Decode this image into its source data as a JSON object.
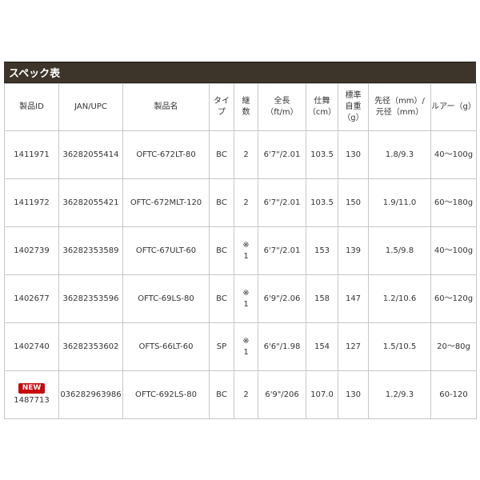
{
  "title": "スペック表",
  "headers": {
    "id": "製品ID",
    "jan": "JAN/UPC",
    "name": "製品名",
    "type_a": "タイ",
    "type_b": "プ",
    "pieces_a": "継",
    "pieces_b": "数",
    "length_a": "全長",
    "length_b": "（ft/m）",
    "close_a": "仕舞",
    "close_b": "（cm）",
    "weight_a": "標準",
    "weight_b": "自重",
    "weight_c": "（g）",
    "dia_a": "先径（mm）/",
    "dia_b": "元径（mm）",
    "lure": "ルアー（g）"
  },
  "new_label": "NEW",
  "rows": [
    {
      "id": "1411971",
      "jan": "36282055414",
      "name": "OFTC-672LT-80",
      "type": "BC",
      "pieces_a": "2",
      "pieces_b": "",
      "length": "6'7\"/2.01",
      "close": "103.5",
      "weight": "130",
      "dia": "1.8/9.3",
      "lure": "40〜100g"
    },
    {
      "id": "1411972",
      "jan": "36282055421",
      "name": "OFTC-672MLT-120",
      "type": "BC",
      "pieces_a": "2",
      "pieces_b": "",
      "length": "6'7\"/2.01",
      "close": "103.5",
      "weight": "150",
      "dia": "1.9/11.0",
      "lure": "60〜180g"
    },
    {
      "id": "1402739",
      "jan": "36282353589",
      "name": "OFTC-67ULT-60",
      "type": "BC",
      "pieces_a": "※",
      "pieces_b": "1",
      "length": "6'7\"/2.01",
      "close": "153",
      "weight": "139",
      "dia": "1.5/9.8",
      "lure": "40〜100g"
    },
    {
      "id": "1402677",
      "jan": "36282353596",
      "name": "OFTC-69LS-80",
      "type": "BC",
      "pieces_a": "※",
      "pieces_b": "1",
      "length": "6'9\"/2.06",
      "close": "158",
      "weight": "147",
      "dia": "1.2/10.6",
      "lure": "60〜120g"
    },
    {
      "id": "1402740",
      "jan": "36282353602",
      "name": "OFTS-66LT-60",
      "type": "SP",
      "pieces_a": "※",
      "pieces_b": "1",
      "length": "6'6\"/1.98",
      "close": "154",
      "weight": "127",
      "dia": "1.5/10.5",
      "lure": "20〜80g"
    },
    {
      "id": "1487713",
      "jan": "036282963986",
      "name": "OFTC-692LS-80",
      "type": "BC",
      "pieces_a": "2",
      "pieces_b": "",
      "length": "6'9\"/206",
      "close": "107.0",
      "weight": "130",
      "dia": "1.2/9.3",
      "lure": "60-120"
    }
  ]
}
